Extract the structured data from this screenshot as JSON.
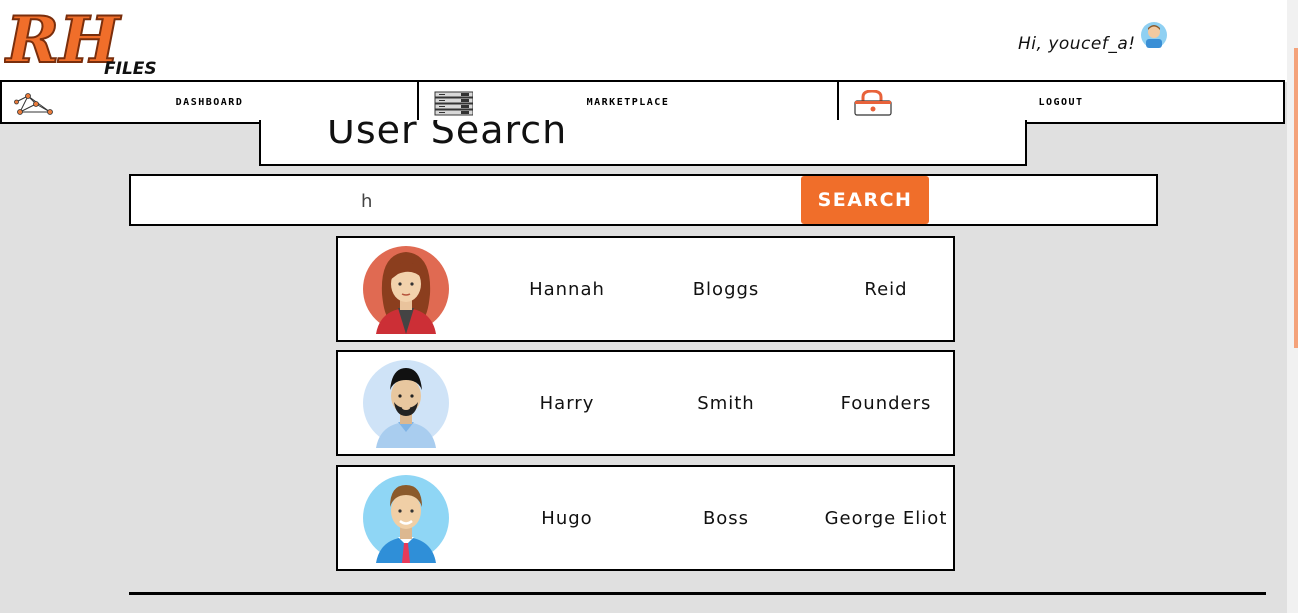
{
  "header": {
    "logo_main": "RH",
    "logo_sub": "FILES",
    "greeting": "Hi, youcef_a!"
  },
  "nav": {
    "items": [
      {
        "label": "DASHBOARD",
        "icon": "network-icon"
      },
      {
        "label": "MARKETPLACE",
        "icon": "server-rack-icon"
      },
      {
        "label": "LOGOUT",
        "icon": "padlock-icon"
      }
    ]
  },
  "page": {
    "title": "User Search"
  },
  "search": {
    "value": "h",
    "button_label": "SEARCH"
  },
  "results": [
    {
      "first": "Hannah",
      "last": "Bloggs",
      "company": "Reid",
      "avatar": "woman-avatar-icon"
    },
    {
      "first": "Harry",
      "last": "Smith",
      "company": "Founders",
      "avatar": "bearded-man-avatar-icon"
    },
    {
      "first": "Hugo",
      "last": "Boss",
      "company": "George Eliot",
      "avatar": "man-tie-avatar-icon"
    }
  ],
  "colors": {
    "accent": "#f06e2a",
    "background": "#e0e0e0"
  }
}
